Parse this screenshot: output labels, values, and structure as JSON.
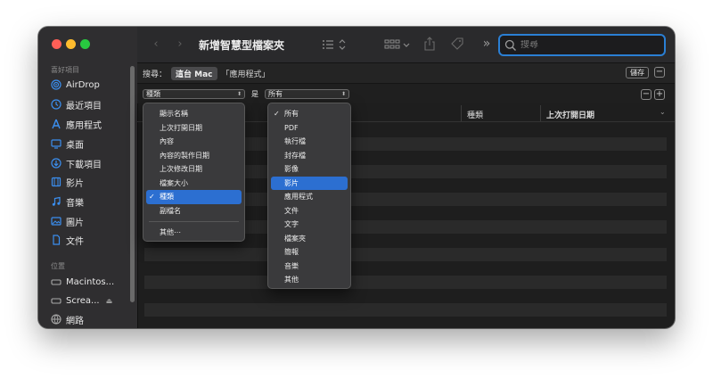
{
  "window": {
    "title": "新增智慧型檔案夾"
  },
  "sidebar": {
    "favorites_header": "喜好項目",
    "items": [
      {
        "label": "AirDrop",
        "icon": "airdrop-icon"
      },
      {
        "label": "最近項目",
        "icon": "clock-icon"
      },
      {
        "label": "應用程式",
        "icon": "applications-icon"
      },
      {
        "label": "桌面",
        "icon": "desktop-icon"
      },
      {
        "label": "下載項目",
        "icon": "download-icon"
      },
      {
        "label": "影片",
        "icon": "film-icon"
      },
      {
        "label": "音樂",
        "icon": "music-icon"
      },
      {
        "label": "圖片",
        "icon": "photo-icon"
      },
      {
        "label": "文件",
        "icon": "document-icon"
      }
    ],
    "locations_header": "位置",
    "locations": [
      {
        "label": "Macintos...",
        "icon": "disk-icon"
      },
      {
        "label": "Screa...",
        "icon": "disk-icon"
      },
      {
        "label": "網路",
        "icon": "network-icon"
      }
    ]
  },
  "toolbar": {
    "search_placeholder": "搜尋"
  },
  "scope": {
    "label": "搜尋：",
    "this_mac": "這台 Mac",
    "applications": "「應用程式」",
    "save": "儲存"
  },
  "criteria": {
    "attribute": "種類",
    "operator": "是",
    "value": "所有"
  },
  "columns": {
    "kind": "種類",
    "last_opened": "上次打開日期"
  },
  "attribute_menu": {
    "items": [
      "顯示名稱",
      "上次打開日期",
      "內容",
      "內容的製作日期",
      "上次修改日期",
      "檔案大小",
      "種類",
      "副檔名"
    ],
    "selected_index": 6,
    "other": "其他⋯"
  },
  "kind_menu": {
    "items": [
      "所有",
      "PDF",
      "執行檔",
      "封存檔",
      "影像",
      "影片",
      "應用程式",
      "文件",
      "文字",
      "檔案夾",
      "簡報",
      "音樂",
      "其他"
    ],
    "checked_index": 0,
    "highlighted_index": 5
  }
}
